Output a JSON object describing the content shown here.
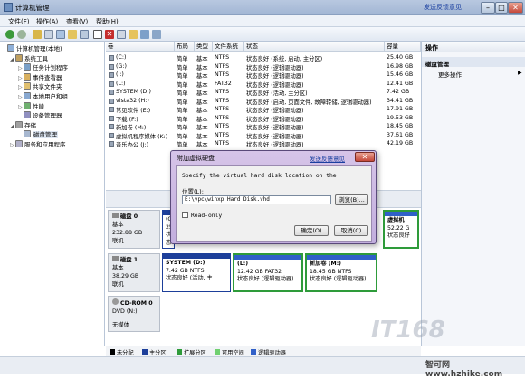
{
  "window": {
    "title": "计算机管理",
    "feedback": "发送反馈意见"
  },
  "menu": [
    "文件(F)",
    "操作(A)",
    "查看(V)",
    "帮助(H)"
  ],
  "tree": [
    {
      "label": "计算机管理(本地)",
      "indent": 0,
      "icon": "computer-icon"
    },
    {
      "label": "系统工具",
      "indent": 1,
      "icon": "tools-icon",
      "exp": "◢"
    },
    {
      "label": "任务计划程序",
      "indent": 2,
      "icon": "task-scheduler-icon",
      "exp": "▷"
    },
    {
      "label": "事件查看器",
      "indent": 2,
      "icon": "event-viewer-icon",
      "exp": "▷"
    },
    {
      "label": "共享文件夹",
      "indent": 2,
      "icon": "shared-folder-icon",
      "exp": "▷"
    },
    {
      "label": "本地用户和组",
      "indent": 2,
      "icon": "users-icon",
      "exp": "▷"
    },
    {
      "label": "性能",
      "indent": 2,
      "icon": "performance-icon",
      "exp": "▷"
    },
    {
      "label": "设备管理器",
      "indent": 2,
      "icon": "device-manager-icon",
      "exp": ""
    },
    {
      "label": "存储",
      "indent": 1,
      "icon": "storage-icon",
      "exp": "◢"
    },
    {
      "label": "磁盘管理",
      "indent": 2,
      "icon": "disk-management-icon",
      "exp": ""
    },
    {
      "label": "服务和应用程序",
      "indent": 1,
      "icon": "services-icon",
      "exp": "▷"
    }
  ],
  "columns": [
    "卷",
    "布局",
    "类型",
    "文件系统",
    "状态",
    "容量"
  ],
  "volumes": [
    {
      "name": "(C:)",
      "layout": "简单",
      "type": "基本",
      "fs": "NTFS",
      "status": "状态良好 (系统, 启动, 主分区)",
      "size": "25.40 GB"
    },
    {
      "name": "(G:)",
      "layout": "简单",
      "type": "基本",
      "fs": "NTFS",
      "status": "状态良好 (逻辑驱动器)",
      "size": "16.98 GB"
    },
    {
      "name": "(I:)",
      "layout": "简单",
      "type": "基本",
      "fs": "NTFS",
      "status": "状态良好 (逻辑驱动器)",
      "size": "15.46 GB"
    },
    {
      "name": "(L:)",
      "layout": "简单",
      "type": "基本",
      "fs": "FAT32",
      "status": "状态良好 (逻辑驱动器)",
      "size": "12.41 GB"
    },
    {
      "name": "SYSTEM (D:)",
      "layout": "简单",
      "type": "基本",
      "fs": "NTFS",
      "status": "状态良好 (活动, 主分区)",
      "size": "7.42 GB"
    },
    {
      "name": "vista32 (H:)",
      "layout": "简单",
      "type": "基本",
      "fs": "NTFS",
      "status": "状态良好 (启动, 页面文件, 故障转储, 逻辑驱动器)",
      "size": "34.41 GB"
    },
    {
      "name": "常见软件 (E:)",
      "layout": "简单",
      "type": "基本",
      "fs": "NTFS",
      "status": "状态良好 (逻辑驱动器)",
      "size": "17.91 GB"
    },
    {
      "name": "下载 (F:)",
      "layout": "简单",
      "type": "基本",
      "fs": "NTFS",
      "status": "状态良好 (逻辑驱动器)",
      "size": "19.53 GB"
    },
    {
      "name": "新加卷 (M:)",
      "layout": "简单",
      "type": "基本",
      "fs": "NTFS",
      "status": "状态良好 (逻辑驱动器)",
      "size": "18.45 GB"
    },
    {
      "name": "虚拟机程序媒体 (K:)",
      "layout": "简单",
      "type": "基本",
      "fs": "NTFS",
      "status": "状态良好 (逻辑驱动器)",
      "size": "37.61 GB"
    },
    {
      "name": "音乐办公 (J:)",
      "layout": "简单",
      "type": "基本",
      "fs": "NTFS",
      "status": "状态良好 (逻辑驱动器)",
      "size": "42.19 GB"
    }
  ],
  "disks": [
    {
      "title": "磁盘 0",
      "type": "基本",
      "size": "232.88 GB",
      "state": "联机"
    },
    {
      "title": "磁盘 1",
      "type": "基本",
      "size": "38.29 GB",
      "state": "联机"
    },
    {
      "title": "CD-ROM 0",
      "type": "DVD (N:)",
      "size": "",
      "state": "无媒体"
    }
  ],
  "partitions": {
    "d0_first": {
      "l1": "(C:)",
      "l2": "25.",
      "l3": "状态"
    },
    "d0_last": {
      "l1": "虚拟机",
      "l2": "52.22 G",
      "l3": "状态良好"
    },
    "d1_system": {
      "l1": "SYSTEM  (D:)",
      "l2": "7.42 GB NTFS",
      "l3": "状态良好 (活动, 主"
    },
    "d1_l": {
      "l1": "(L:)",
      "l2": "12.42 GB FAT32",
      "l3": "状态良好 (逻辑驱动器)"
    },
    "d1_m": {
      "l1": "新加卷  (M:)",
      "l2": "18.45 GB NTFS",
      "l3": "状态良好 (逻辑驱动器)"
    }
  },
  "actions": {
    "header": "操作",
    "section": "磁盘管理",
    "more": "更多操作"
  },
  "legend": [
    {
      "label": "未分配",
      "color": "#000000"
    },
    {
      "label": "主分区",
      "color": "#1d3f9a"
    },
    {
      "label": "扩展分区",
      "color": "#2e9b3a"
    },
    {
      "label": "可用空间",
      "color": "#70d070"
    },
    {
      "label": "逻辑驱动器",
      "color": "#3060c8"
    }
  ],
  "dialog": {
    "title": "附加虚拟硬盘",
    "feedback": "发送反馈意见",
    "prompt": "Specify the virtual hard disk location on the",
    "location_label": "位置(L):",
    "path": "E:\\vpc\\winxp Hard Disk.vhd",
    "browse": "浏览(B)...",
    "readonly": "Read-only",
    "ok": "确定(O)",
    "cancel": "取消(C)"
  },
  "watermark": {
    "text": "IT168",
    "site": "智可网 www.hzhike.com"
  }
}
